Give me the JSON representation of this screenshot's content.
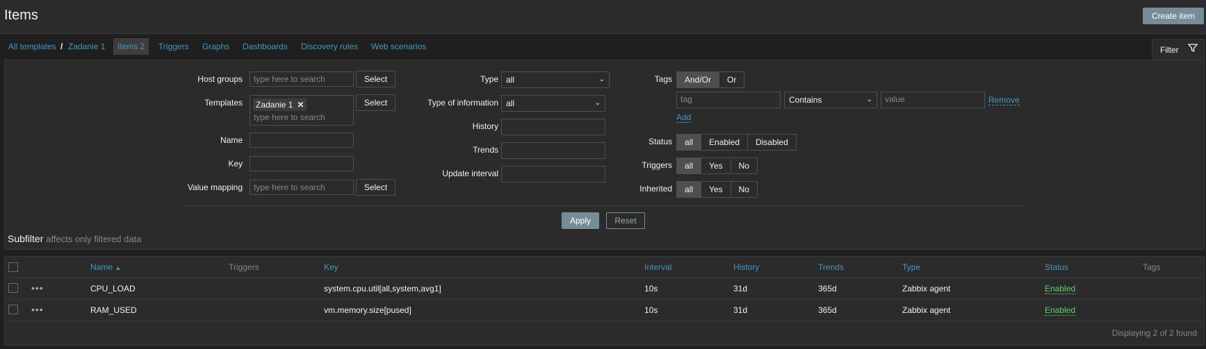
{
  "header": {
    "title": "Items",
    "create_button": "Create item"
  },
  "nav": {
    "breadcrumb_all": "All templates",
    "breadcrumb_sep": "/",
    "breadcrumb_template": "Zadanie 1",
    "tabs": [
      {
        "label": "Items",
        "count": "2"
      },
      {
        "label": "Triggers"
      },
      {
        "label": "Graphs"
      },
      {
        "label": "Dashboards"
      },
      {
        "label": "Discovery rules"
      },
      {
        "label": "Web scenarios"
      }
    ],
    "filter_label": "Filter"
  },
  "filter": {
    "host_groups": {
      "label": "Host groups",
      "placeholder": "type here to search",
      "button": "Select"
    },
    "templates": {
      "label": "Templates",
      "chip": "Zadanie 1",
      "placeholder": "type here to search",
      "button": "Select"
    },
    "name": {
      "label": "Name",
      "value": ""
    },
    "key": {
      "label": "Key",
      "value": ""
    },
    "value_mapping": {
      "label": "Value mapping",
      "placeholder": "type here to search",
      "button": "Select"
    },
    "type": {
      "label": "Type",
      "value": "all"
    },
    "type_of_information": {
      "label": "Type of information",
      "value": "all"
    },
    "history": {
      "label": "History",
      "value": ""
    },
    "trends": {
      "label": "Trends",
      "value": ""
    },
    "update_interval": {
      "label": "Update interval",
      "value": ""
    },
    "tags": {
      "label": "Tags",
      "options": [
        "And/Or",
        "Or"
      ],
      "tag_placeholder": "tag",
      "operator": "Contains",
      "value_placeholder": "value",
      "remove": "Remove",
      "add": "Add"
    },
    "status": {
      "label": "Status",
      "options": [
        "all",
        "Enabled",
        "Disabled"
      ]
    },
    "triggers": {
      "label": "Triggers",
      "options": [
        "all",
        "Yes",
        "No"
      ]
    },
    "inherited": {
      "label": "Inherited",
      "options": [
        "all",
        "Yes",
        "No"
      ]
    },
    "apply": "Apply",
    "reset": "Reset"
  },
  "subfilter": {
    "title": "Subfilter",
    "note": "affects only filtered data"
  },
  "table": {
    "headers": {
      "name": "Name",
      "triggers": "Triggers",
      "key": "Key",
      "interval": "Interval",
      "history": "History",
      "trends": "Trends",
      "type": "Type",
      "status": "Status",
      "tags": "Tags"
    },
    "rows": [
      {
        "name": "CPU_LOAD",
        "key": "system.cpu.util[all,system,avg1]",
        "interval": "10s",
        "history": "31d",
        "trends": "365d",
        "type": "Zabbix agent",
        "status": "Enabled"
      },
      {
        "name": "RAM_USED",
        "key": "vm.memory.size[pused]",
        "interval": "10s",
        "history": "31d",
        "trends": "365d",
        "type": "Zabbix agent",
        "status": "Enabled"
      }
    ],
    "footer": "Displaying 2 of 2 found"
  }
}
